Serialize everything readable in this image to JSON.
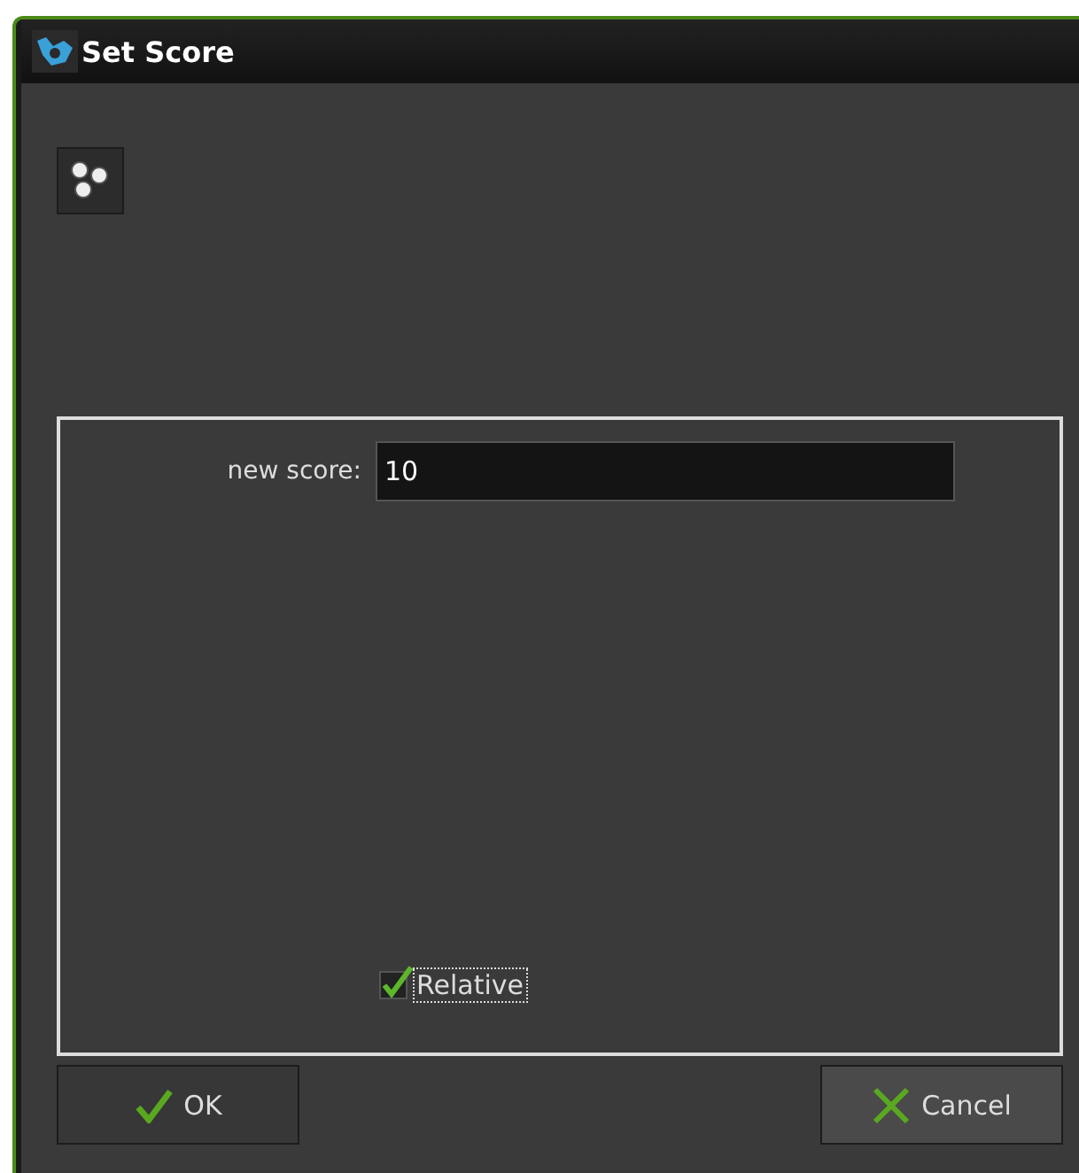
{
  "window": {
    "title": "Set Score"
  },
  "field": {
    "label": "new score:",
    "value": "10"
  },
  "checkbox": {
    "label": "Relative",
    "checked": true,
    "focused": true
  },
  "buttons": [
    {
      "kind": "ok",
      "label": "OK",
      "highlighted": false
    },
    {
      "kind": "cancel",
      "label": "Cancel",
      "highlighted": true
    }
  ]
}
